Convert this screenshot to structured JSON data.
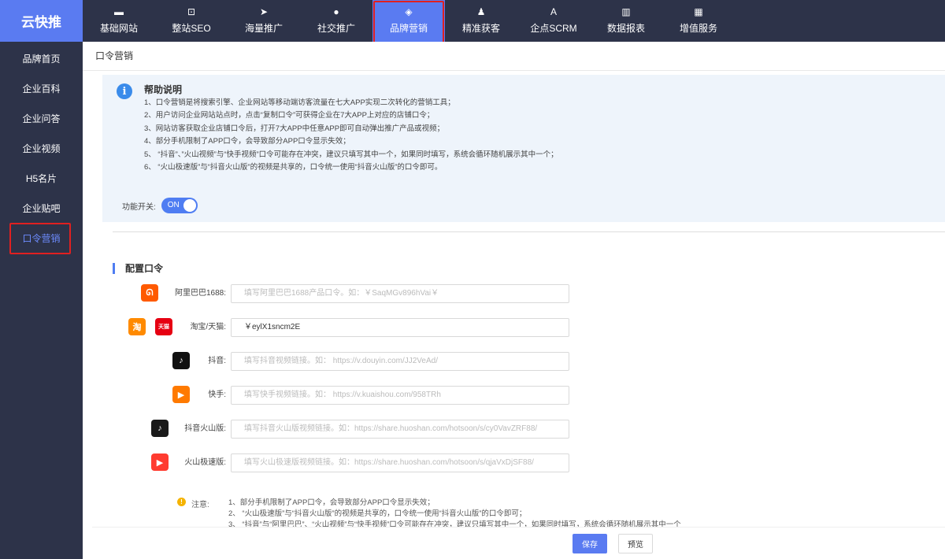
{
  "app": {
    "logo": "云快推"
  },
  "nav": {
    "items": [
      {
        "label": "基础网站",
        "icon": "monitor-icon",
        "glyph": "▬"
      },
      {
        "label": "整站SEO",
        "icon": "chart-screen-icon",
        "glyph": "⊡"
      },
      {
        "label": "海量推广",
        "icon": "paper-plane-icon",
        "glyph": "➤"
      },
      {
        "label": "社交推广",
        "icon": "chat-bubble-icon",
        "glyph": "●"
      },
      {
        "label": "品牌营销",
        "icon": "tag-icon",
        "glyph": "◈"
      },
      {
        "label": "精准获客",
        "icon": "user-icon",
        "glyph": "♟"
      },
      {
        "label": "企点SCRM",
        "icon": "a-letter-icon",
        "glyph": "A"
      },
      {
        "label": "数据报表",
        "icon": "bar-chart-icon",
        "glyph": "▥"
      },
      {
        "label": "增值服务",
        "icon": "grid-icon",
        "glyph": "▦"
      }
    ],
    "active_index": 4
  },
  "sidebar": {
    "items": [
      {
        "label": "品牌首页"
      },
      {
        "label": "企业百科"
      },
      {
        "label": "企业问答"
      },
      {
        "label": "企业视频"
      },
      {
        "label": "H5名片"
      },
      {
        "label": "企业贴吧"
      },
      {
        "label": "口令营销"
      }
    ],
    "active_index": 6
  },
  "breadcrumb": "口令营销",
  "help": {
    "title": "帮助说明",
    "lines": [
      "1、口令营销是将搜索引擎、企业网站等移动端访客流量在七大APP实现二次转化的营销工具；",
      "2、用户访问企业网站站点时，点击“复制口令”可获得企业在7大APP上对应的店铺口令；",
      "3、网站访客获取企业店铺口令后，打开7大APP中任意APP即可自动弹出推广产品或视频；",
      "4、部分手机限制了APP口令，会导致部分APP口令显示失效；",
      "5、 “抖音”、”火山视频”与“快手视频”口令可能存在冲突，建议只填写其中一个，如果同时填写，系统会循环随机展示其中一个；",
      "6、 “火山极速版”与“抖音火山版”的视频是共享的，口令统一使用“抖音火山版”的口令即可。"
    ]
  },
  "switch": {
    "label": "功能开关:",
    "state": "ON"
  },
  "config": {
    "title": "配置口令",
    "rows": [
      {
        "label": "阿里巴巴1688:",
        "value": "",
        "placeholder": "填写阿里巴巴1688产品口令。如：￥SaqMGv896hVai￥"
      },
      {
        "label": "淘宝/天猫:",
        "value": "￥eylX1sncm2E",
        "placeholder": ""
      },
      {
        "label": "抖音:",
        "value": "",
        "placeholder": "填写抖音视频链接。如： https://v.douyin.com/JJ2VeAd/"
      },
      {
        "label": "快手:",
        "value": "",
        "placeholder": "填写快手视频链接。如： https://v.kuaishou.com/958TRh"
      },
      {
        "label": "抖音火山版:",
        "value": "",
        "placeholder": "填写抖音火山版视频链接。如：https://share.huoshan.com/hotsoon/s/cy0VavZRF88/"
      },
      {
        "label": "火山极速版:",
        "value": "",
        "placeholder": "填写火山极速版视频链接。如：https://share.huoshan.com/hotsoon/s/qjaVxDjSF88/"
      }
    ]
  },
  "apps": {
    "alibaba": {
      "glyph": "ᘏ",
      "color": "#ff5a00"
    },
    "taobao": {
      "glyph": "淘",
      "color": "#ff8a00"
    },
    "tmall": {
      "glyph": "天猫",
      "color": "#e60012"
    },
    "douyin": {
      "glyph": "♪",
      "color": "#111111"
    },
    "kuaishou": {
      "glyph": "▶",
      "color": "#ff7a00"
    },
    "huoshan": {
      "glyph": "♪",
      "color": "#1a1a1a"
    },
    "huoshan_lite": {
      "glyph": "▶",
      "color": "#ff3b30"
    }
  },
  "notes": {
    "label": "注意:",
    "lines": [
      "1、部分手机限制了APP口令，会导致部分APP口令显示失效；",
      "2、 “火山极速版”与“抖音火山版”的视频是共享的，口令统一使用“抖音火山版”的口令即可；",
      "3、 “抖音”与“阿里巴巴”、“火山视频”与“快手视频”口令可能存在冲突，建议只填写其中一个，如果同时填写，系统会循环随机展示其中一个"
    ]
  },
  "buttons": {
    "save": "保存",
    "preview": "预览"
  },
  "colors": {
    "sidebar": "#2d3349",
    "accent": "#5a7bf1",
    "highlight": "#e02020"
  }
}
